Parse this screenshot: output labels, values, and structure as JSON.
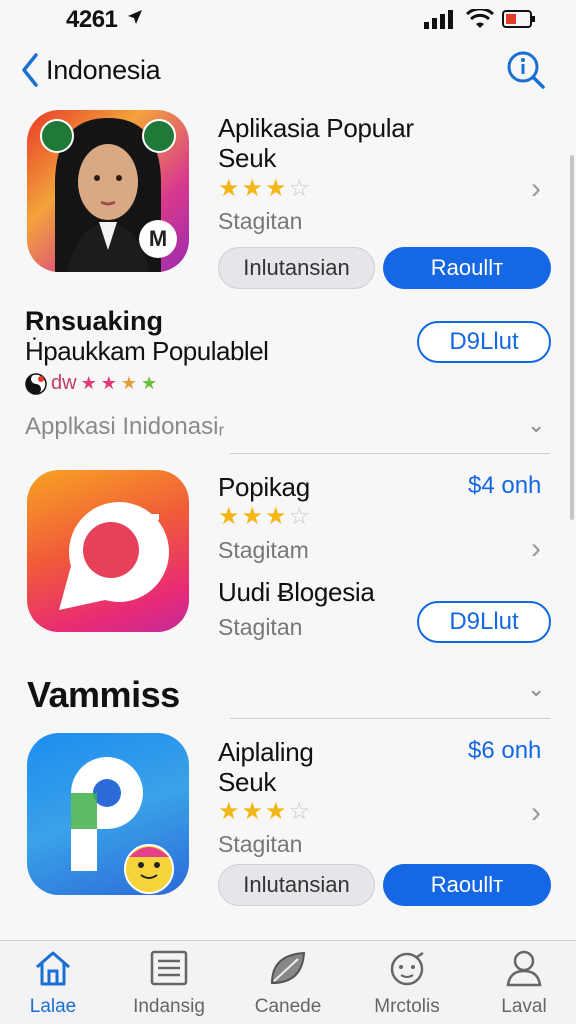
{
  "status_bar": {
    "time": "4261"
  },
  "nav": {
    "back_label": "Indonesia"
  },
  "featured": {
    "title_line1": "Aplikasia Popular",
    "title_line2": "Seuk",
    "rating": 3.5,
    "subtitle": "Stagitan",
    "button_secondary": "Inlutansian",
    "button_primary": "Raoullт",
    "badge_letter": "M"
  },
  "ranking": {
    "title_line1": "Rnsuaking",
    "title_line2": "Ḣpaukkam Populablel",
    "meta": "dw",
    "button": "D9Llut"
  },
  "section_apps": {
    "title": "Applkasi Inidonasiᵣ"
  },
  "app2": {
    "title": "Popikag",
    "price": "$4 onh",
    "rating": 3.5,
    "subtitle": "Stagitam",
    "title2": "Uudi Ƀlogesia",
    "subtitle2": "Stagitan",
    "button": "D9Llut"
  },
  "section_vammiss": {
    "title": "Vammiss"
  },
  "app3": {
    "title_line1": "Aiplaling",
    "title_line2": "Seuk",
    "price": "$6 onh",
    "rating": 3.5,
    "subtitle": "Stagitan",
    "button_secondary": "Inlutansian",
    "button_primary": "Raoullт"
  },
  "tabs": [
    {
      "label": "Lalae",
      "icon": "home-icon",
      "active": true
    },
    {
      "label": "Indansig",
      "icon": "list-icon",
      "active": false
    },
    {
      "label": "Canede",
      "icon": "leaf-icon",
      "active": false
    },
    {
      "label": "Mrctolis",
      "icon": "face-icon",
      "active": false
    },
    {
      "label": "Laval",
      "icon": "person-icon",
      "active": false
    }
  ],
  "colors": {
    "accent": "#1567e3",
    "star": "#f2b617"
  }
}
